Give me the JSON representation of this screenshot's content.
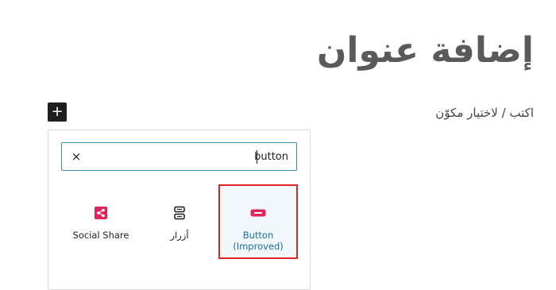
{
  "editor": {
    "title": "إضافة عنوان",
    "placeholder": "اكتب / لاختيار مكوّن",
    "add_block_symbol": "+"
  },
  "inserter": {
    "search_value": "button",
    "clear_symbol": "×",
    "results": [
      {
        "label": "Social Share",
        "icon": "share-icon",
        "icon_color": "#e2245a"
      },
      {
        "label": "أزرار",
        "icon": "buttons-icon",
        "icon_color": "#1e1e1e"
      },
      {
        "label": "Button (Improved)",
        "icon": "button-improved-icon",
        "icon_color": "#e2245a"
      }
    ]
  },
  "colors": {
    "highlight_border": "#e02424",
    "accent_text": "#1a6f9e",
    "search_border": "#3b8fb0"
  }
}
